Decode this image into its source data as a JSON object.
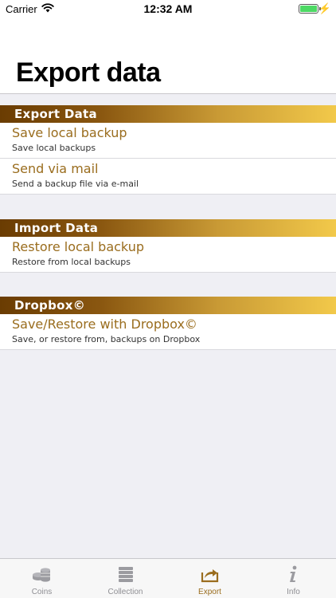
{
  "status_bar": {
    "carrier": "Carrier",
    "time": "12:32 AM"
  },
  "header": {
    "title": "Export data"
  },
  "sections": [
    {
      "title": "Export Data",
      "rows": [
        {
          "title": "Save local backup",
          "subtitle": "Save local backups"
        },
        {
          "title": "Send via mail",
          "subtitle": "Send a backup file via e-mail"
        }
      ]
    },
    {
      "title": "Import Data",
      "rows": [
        {
          "title": "Restore local backup",
          "subtitle": "Restore from local backups"
        }
      ]
    },
    {
      "title": "Dropbox©",
      "rows": [
        {
          "title": "Save/Restore with Dropbox©",
          "subtitle": "Save, or restore from, backups on Dropbox"
        }
      ]
    }
  ],
  "tabbar": {
    "tabs": [
      {
        "label": "Coins",
        "icon": "coins-icon",
        "active": false
      },
      {
        "label": "Collection",
        "icon": "collection-icon",
        "active": false
      },
      {
        "label": "Export",
        "icon": "export-icon",
        "active": true
      },
      {
        "label": "Info",
        "icon": "info-icon",
        "active": false
      }
    ]
  },
  "colors": {
    "accent": "#9a6d1e",
    "inactive": "#8e8e93",
    "header_gradient_start": "#6a3c02",
    "header_gradient_end": "#f2c94a"
  }
}
